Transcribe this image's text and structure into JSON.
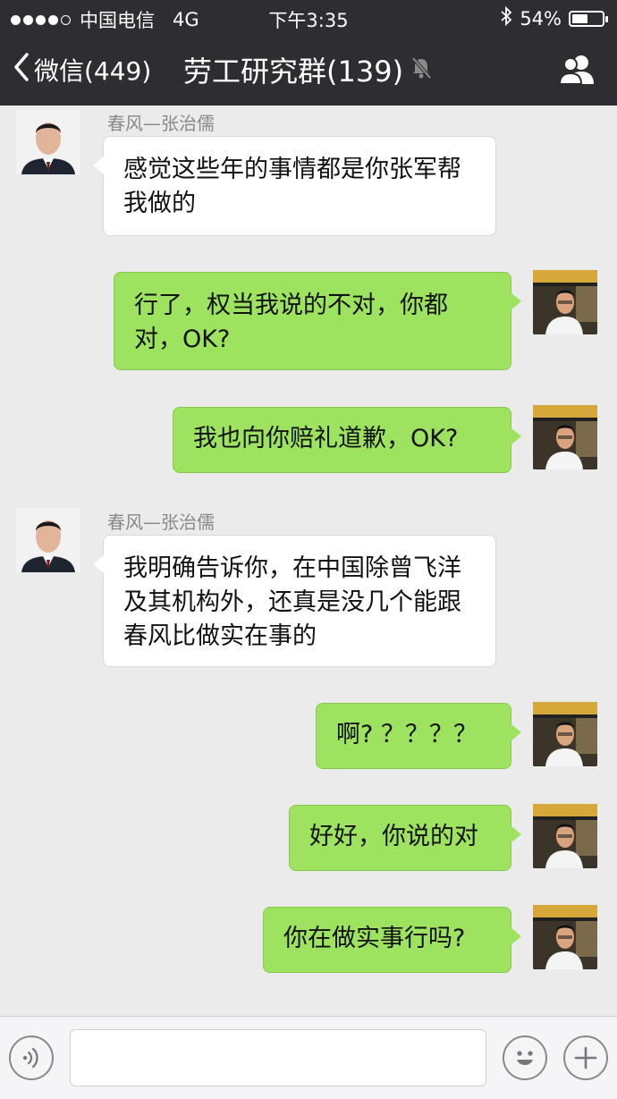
{
  "status_bar": {
    "carrier": "中国电信",
    "network": "4G",
    "time": "下午3:35",
    "battery": "54%",
    "battery_level": 0.54,
    "signal_icon": "signal-dots-icon",
    "bluetooth_icon": "bluetooth-icon"
  },
  "nav": {
    "back_label": "微信(449)",
    "title": "劳工研究群(139)",
    "mute_icon": "mute-bell-icon",
    "members_icon": "group-members-icon"
  },
  "messages": [
    {
      "direction": "in",
      "sender": "春风—张治儒",
      "text": "感觉这些年的事情都是你张军帮我做的"
    },
    {
      "direction": "out",
      "text": "行了，权当我说的不对，你都对，OK?"
    },
    {
      "direction": "out",
      "text": "我也向你赔礼道歉，OK?"
    },
    {
      "direction": "in",
      "sender": "春风—张治儒",
      "text": "我明确告诉你，在中国除曾飞洋及其机构外，还真是没几个能跟春风比做实在事的"
    },
    {
      "direction": "out",
      "text": "啊? ？？？？"
    },
    {
      "direction": "out",
      "text": "好好，你说的对"
    },
    {
      "direction": "out",
      "text": "你在做实事行吗?"
    }
  ],
  "input_bar": {
    "voice_icon": "voice-icon",
    "emoji_icon": "emoji-icon",
    "plus_icon": "plus-icon",
    "placeholder": ""
  },
  "colors": {
    "bar_background": "#2e2e32",
    "chat_background": "#ebebeb",
    "outgoing_bubble": "#9de35f",
    "incoming_bubble": "#ffffff"
  }
}
